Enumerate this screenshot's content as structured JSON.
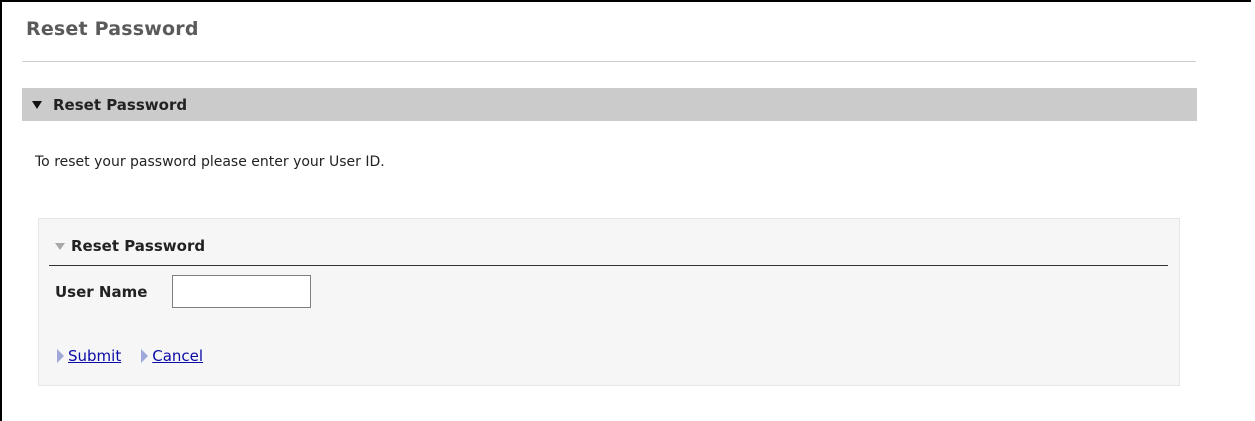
{
  "page": {
    "title": "Reset Password"
  },
  "section": {
    "label": "Reset Password",
    "icon": "triangle-down-icon"
  },
  "instructions": "To reset your password please enter your User ID.",
  "panel": {
    "label": "Reset Password",
    "icon": "triangle-down-icon",
    "field": {
      "label": "User Name",
      "value": "",
      "placeholder": ""
    },
    "actions": {
      "submit_label": "Submit",
      "cancel_label": "Cancel",
      "icon": "triangle-right-icon"
    }
  },
  "colors": {
    "section_bar": "#cbcbcb",
    "panel_bg": "#f6f6f6",
    "link": "#0a0aa6",
    "action_arrow": "#9fa6d8"
  }
}
